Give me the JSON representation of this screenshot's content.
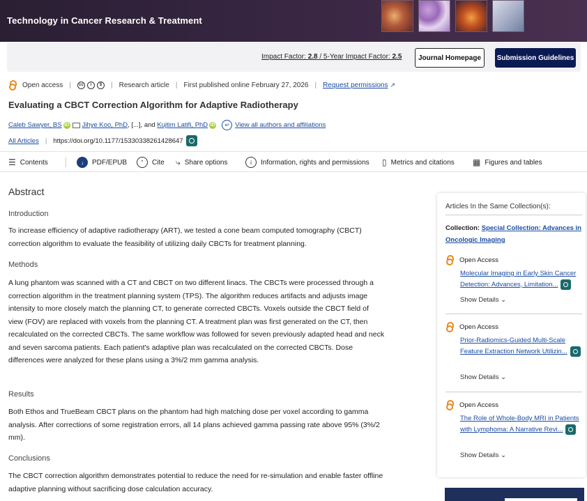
{
  "header": {
    "journal_title": "Technology in Cancer Research & Treatment"
  },
  "journal_bar": {
    "impact_label": "Impact Factor: ",
    "impact_value": "2.8",
    "five_year_label": " / 5-Year Impact Factor: ",
    "five_year_value": "2.5",
    "homepage_button": "Journal Homepage",
    "guidelines_button": "Submission Guidelines"
  },
  "meta": {
    "open_access": "Open access",
    "license_icons": [
      "cc-icon",
      "by-icon",
      "nc-icon"
    ],
    "article_type": "Research article",
    "published": "First published online February 27, 2026",
    "permissions": "Request permissions"
  },
  "article": {
    "title": "Evaluating a CBCT Correction Algorithm for Adaptive Radiotherapy",
    "author1": "Caleb Sawyer, BS",
    "author2": "Jihye Koo, PhD",
    "ellipsis": ", [...], and ",
    "author3": "Kujtim Latifi, PhD",
    "all_authors": "View all authors and affiliations",
    "all_articles": "All Articles",
    "doi": "https://doi.org/10.1177/15330338261428647"
  },
  "toolbar": {
    "contents": "Contents",
    "pdf": "PDF/EPUB",
    "cite": "Cite",
    "share": "Share options",
    "info": "Information, rights and permissions",
    "metrics": "Metrics and citations",
    "figures": "Figures and tables"
  },
  "abstract": {
    "heading": "Abstract",
    "intro_h": "Introduction",
    "intro": "To increase efficiency of adaptive radiotherapy (ART), we tested a cone beam computed tomography (CBCT) correction algorithm to evaluate the feasibility of utilizing daily CBCTs for treatment planning.",
    "methods_h": "Methods",
    "methods": "A lung phantom was scanned with a CT and CBCT on two different linacs. The CBCTs were processed through a correction algorithm in the treatment planning system (TPS). The algorithm reduces artifacts and adjusts image intensity to more closely match the planning CT, to generate corrected CBCTs. Voxels outside the CBCT field of view (FOV) are replaced with voxels from the planning CT. A treatment plan was first generated on the CT, then recalculated on the corrected CBCTs. The same workflow was followed for seven previously adapted head and neck and seven sarcoma patients. Each patient's adaptive plan was recalculated on the corrected CBCTs. Dose differences were analyzed for these plans using a 3%/2 mm gamma analysis.",
    "results_h": "Results",
    "results": "Both Ethos and TrueBeam CBCT plans on the phantom had high matching dose per voxel according to gamma analysis. After corrections of some registration errors, all 14 plans achieved gamma passing rate above 95% (3%/2 mm).",
    "conclusions_h": "Conclusions",
    "conclusions": "The CBCT correction algorithm demonstrates potential to reduce the need for re-simulation and enable faster offline adaptive planning without sacrificing dose calculation accuracy."
  },
  "sidebar": {
    "title": "Articles In the Same Collection(s):",
    "collection_label": "Collection: ",
    "collection_name": "Special Collection: Advances in Oncologic Imaging",
    "items": [
      {
        "oa": "Open Access",
        "title": "Molecular Imaging in Early Skin Cancer Detection: Advances, Limitation...",
        "show": "Show Details"
      },
      {
        "oa": "Open Access",
        "title": "Prior-Radiomics-Guided Multi-Scale Feature Extraction Network Utilizin...",
        "show": "Show Details"
      },
      {
        "oa": "Open Access",
        "title": "The Role of Whole-Body MRI in Patients with Lymphoma: A Narrative Revi...",
        "show": "Show Details"
      }
    ]
  }
}
